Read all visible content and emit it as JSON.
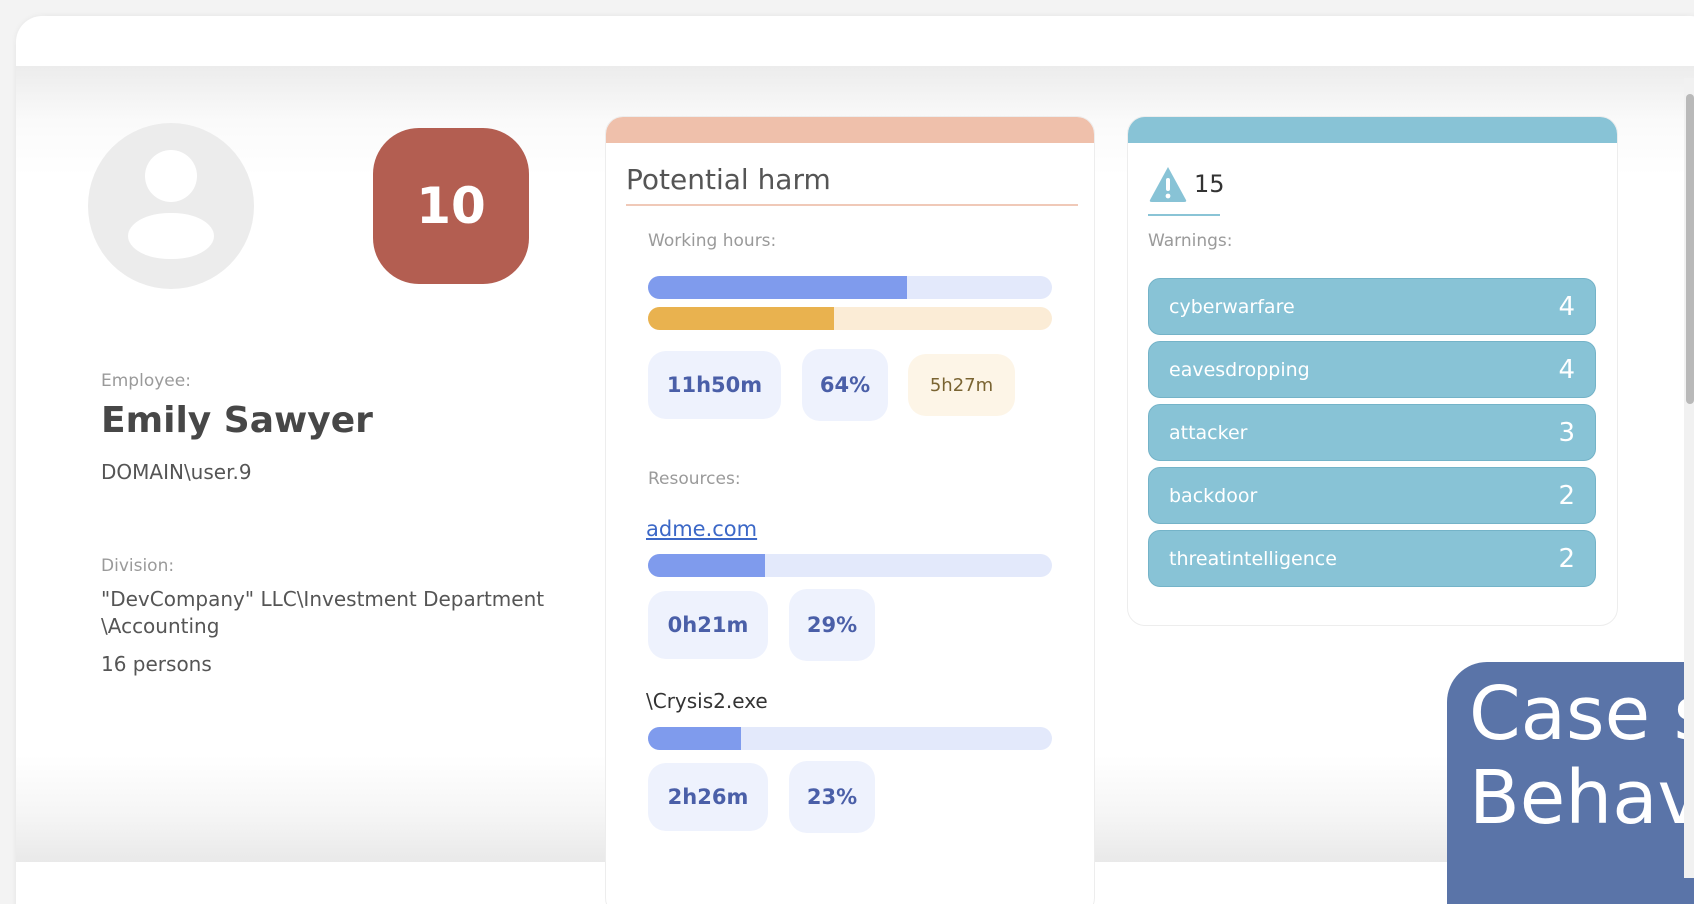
{
  "colors": {
    "score_bg": "#b35e51",
    "harm_accent": "#efc0ab",
    "warn_accent": "#88c3d6",
    "bar_blue": "#7f9bed",
    "bar_blue_track": "#e3e9fb",
    "bar_orange": "#e9b24f",
    "bar_orange_track": "#fbecd6",
    "banner_bg": "#5a74a8"
  },
  "profile": {
    "score": "10",
    "employee_label": "Employee:",
    "name": "Emily Sawyer",
    "login": "DOMAIN\\user.9",
    "division_label": "Division:",
    "division_line1": "\"DevCompany\" LLC\\Investment Department",
    "division_line2": "\\Accounting",
    "persons": "16 persons",
    "avatar_icon": "user-avatar-icon"
  },
  "harm": {
    "title": "Potential harm",
    "working_hours_label": "Working hours:",
    "working_blue_fraction": 0.64,
    "working_orange_fraction": 0.46,
    "working_time": "11h50m",
    "working_percent": "64%",
    "working_extra": "5h27m",
    "resources_label": "Resources:",
    "resources": [
      {
        "name": "adme.com",
        "is_link": true,
        "fraction": 0.29,
        "time": "0h21m",
        "percent": "29%"
      },
      {
        "name": "\\Crysis2.exe",
        "is_link": false,
        "fraction": 0.23,
        "time": "2h26m",
        "percent": "23%"
      }
    ]
  },
  "warnings": {
    "icon": "warning-triangle-icon",
    "total": "15",
    "label": "Warnings:",
    "items": [
      {
        "name": "cyberwarfare",
        "count": "4"
      },
      {
        "name": "eavesdropping",
        "count": "4"
      },
      {
        "name": "attacker",
        "count": "3"
      },
      {
        "name": "backdoor",
        "count": "2"
      },
      {
        "name": "threatintelligence",
        "count": "2"
      }
    ]
  },
  "banner": {
    "line1": "Case s",
    "line2": "Behav"
  }
}
